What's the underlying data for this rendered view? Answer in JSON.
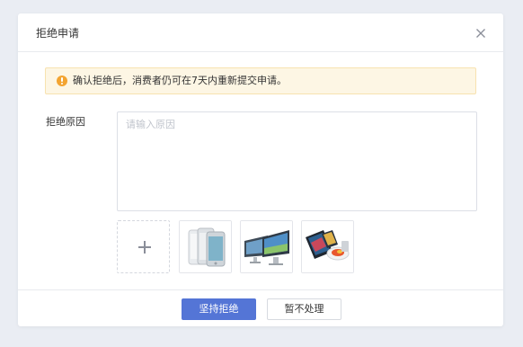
{
  "dialog": {
    "title": "拒绝申请",
    "close_icon": "close-icon"
  },
  "alert": {
    "icon": "warning-icon",
    "text": "确认拒绝后，消费者仍可在7天内重新提交申请。",
    "color": "#f3a431"
  },
  "form": {
    "reason_label": "拒绝原因",
    "reason_placeholder": "请输入原因",
    "reason_value": ""
  },
  "upload": {
    "add_icon": "plus-icon",
    "thumbnails": [
      {
        "depicts": "iphone-product-image"
      },
      {
        "depicts": "imac-product-image"
      },
      {
        "depicts": "tablet-accessories-product-image"
      }
    ]
  },
  "footer": {
    "confirm_label": "坚持拒绝",
    "cancel_label": "暂不处理",
    "accent_color": "#5475d6"
  }
}
